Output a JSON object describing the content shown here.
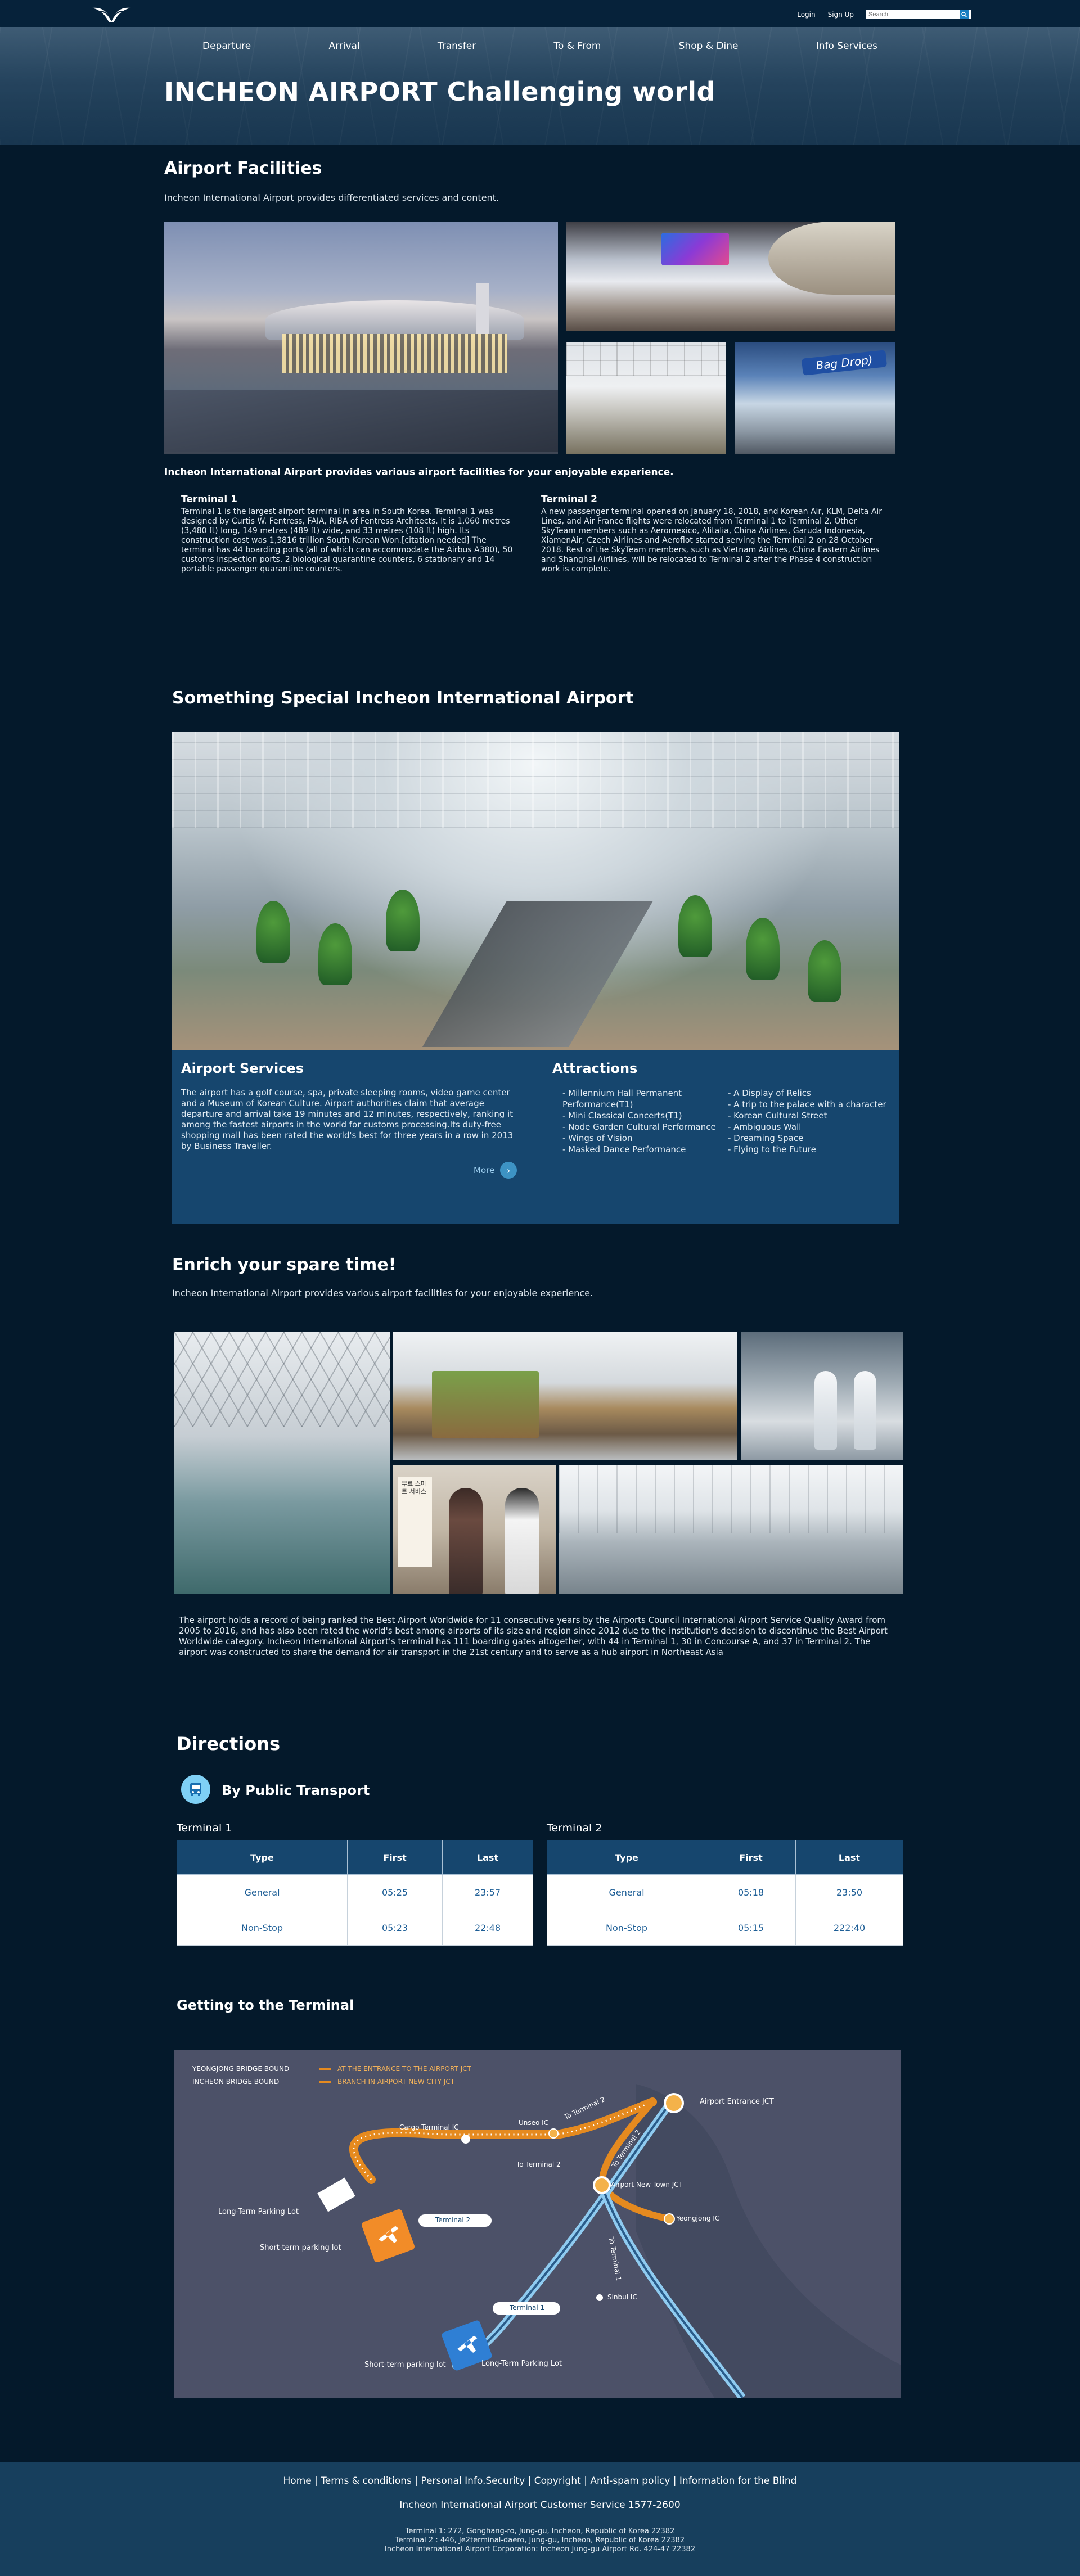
{
  "header": {
    "login": "Login",
    "signup": "Sign Up",
    "search_placeholder": "Search"
  },
  "nav": [
    "Departure",
    "Arrival",
    "Transfer",
    "To & From",
    "Shop & Dine",
    "Info Services"
  ],
  "hero": {
    "title": "INCHEON AIRPORT Challenging world"
  },
  "facilities": {
    "title": "Airport Facilities",
    "intro": "Incheon International Airport provides differentiated services and content.",
    "subtitle": "Incheon International Airport provides various airport facilities for your enjoyable experience.",
    "checkin_sign": "Bag Drop)",
    "terminal1": {
      "title": "Terminal 1",
      "text": "Terminal 1 is the largest airport terminal in area in South Korea. Terminal 1 was designed by Curtis W. Fentress, FAIA, RIBA of Fentress Architects. It is 1,060 metres (3,480 ft) long, 149 metres (489 ft) wide, and 33 metres (108 ft) high. Its construction cost was 1,3816 trillion South Korean Won.[citation needed] The terminal has 44 boarding ports (all of which can accommodate the Airbus A380), 50 customs inspection ports, 2 biological quarantine counters, 6 stationary and 14 portable passenger quarantine counters."
    },
    "terminal2": {
      "title": "Terminal 2",
      "text": "A new passenger terminal opened on January 18, 2018, and Korean Air, KLM, Delta Air Lines, and Air France flights were relocated from Terminal 1 to Terminal 2. Other SkyTeam members such as Aeromexico, Alitalia, China Airlines, Garuda Indonesia, XiamenAir, Czech Airlines and Aeroflot started serving the Terminal 2 on 28 October 2018. Rest of the SkyTeam members, such as Vietnam Airlines, China Eastern Airlines and Shanghai Airlines, will be relocated to Terminal 2 after the Phase 4 construction work is complete."
    }
  },
  "special": {
    "title": "Something Special Incheon International Airport",
    "services": {
      "title": "Airport Services",
      "text": "The airport has a golf course, spa, private sleeping rooms, video game center and a Museum of Korean Culture. Airport authorities claim that average departure and arrival take 19 minutes and 12 minutes, respectively, ranking it among the fastest airports in the world for customs processing.Its duty-free shopping mall has been rated the world's best for three years in a row in 2013 by Business Traveller.",
      "more": "More"
    },
    "attractions": {
      "title": "Attractions",
      "col1": [
        "- Millennium Hall Permanent Performance(T1)",
        "- Mini Classical Concerts(T1)",
        "- Node Garden Cultural Performance",
        "- Wings of Vision",
        "- Masked Dance Performance"
      ],
      "col2": [
        "- A Display of Relics",
        "- A trip to the palace with a character",
        "- Korean Cultural Street",
        "- Ambiguous Wall",
        "- Dreaming Space",
        "- Flying to the Future"
      ]
    }
  },
  "spare": {
    "title": "Enrich your spare time!",
    "intro": "Incheon International Airport provides various airport facilities for your enjoyable experience.",
    "photo_sign": "무료 스마트 서비스",
    "text": "The airport holds a record of being ranked the Best Airport Worldwide for 11 consecutive years by the Airports Council International Airport Service Quality Award from 2005 to 2016, and has also been rated the world's best among airports of its size and region since 2012 due to the institution's decision to discontinue the Best Airport Worldwide category. Incheon International Airport's terminal has 111 boarding gates altogether, with 44 in Terminal 1, 30 in Concourse A, and 37 in Terminal 2. The airport was constructed to share the demand for air transport in the 21st century and to serve as a hub airport in Northeast Asia"
  },
  "directions": {
    "title": "Directions",
    "transport_title": "By Public Transport",
    "columns": [
      "Type",
      "First",
      "Last"
    ],
    "terminal1": {
      "title": "Terminal 1",
      "rows": [
        [
          "General",
          "05:25",
          "23:57"
        ],
        [
          "Non-Stop",
          "05:23",
          "22:48"
        ]
      ]
    },
    "terminal2": {
      "title": "Terminal 2",
      "rows": [
        [
          "General",
          "05:18",
          "23:50"
        ],
        [
          "Non-Stop",
          "05:15",
          "222:40"
        ]
      ]
    },
    "getting_title": "Getting to the Terminal"
  },
  "map": {
    "legend1_left": "YEONGJONG BRIDGE BOUND",
    "legend1_right": "AT THE ENTRANCE TO THE AIRPORT JCT",
    "legend2_left": "INCHEON BRIDGE BOUND",
    "legend2_right": "BRANCH IN AIRPORT NEW CITY JCT",
    "labels": {
      "airport_entrance": "Airport Entrance JCT",
      "cargo": "Cargo Terminal IC",
      "unseo": "Unseo IC",
      "to_t2_a": "To Terminal 2",
      "to_t2_b": "To Terminal 2",
      "to_t2_c": "To Terminal 2",
      "new_town": "Airport New Town JCT",
      "yeongjong": "Yeongjong IC",
      "long_term_1": "Long-Term Parking Lot",
      "short_term_1": "Short-term parking lot",
      "terminal2": "Terminal 2",
      "to_t1": "To Terminal 1",
      "terminal1": "Terminal 1",
      "sinbul": "Sinbul IC",
      "short_term_2": "Short-term parking lot",
      "long_term_2": "Long-Term Parking Lot"
    }
  },
  "footer": {
    "links": [
      "Home",
      "Terms & conditions",
      "Personal Info.Security",
      "Copyright",
      "Anti-spam policy",
      "Information for the Blind"
    ],
    "customer_service": "Incheon International Airport Customer Service 1577-2600",
    "addr1": "Terminal 1: 272, Gonghang-ro, Jung-gu, Incheon, Republic of Korea 22382",
    "addr2": "Terminal 2 : 446, Je2terminal-daero, Jung-gu, Incheon, Republic of Korea 22382",
    "addr3": "Incheon International Airport Corporation: Incheon Jung-gu Airport Rd. 424-47 22382"
  },
  "colors": {
    "page_bg": "#04192b",
    "panel_blue": "#16466e",
    "footer_bg": "#173f5d",
    "accent": "#3d93c4",
    "route_orange": "#f29a2e",
    "route_blue": "#8fcbf0"
  }
}
